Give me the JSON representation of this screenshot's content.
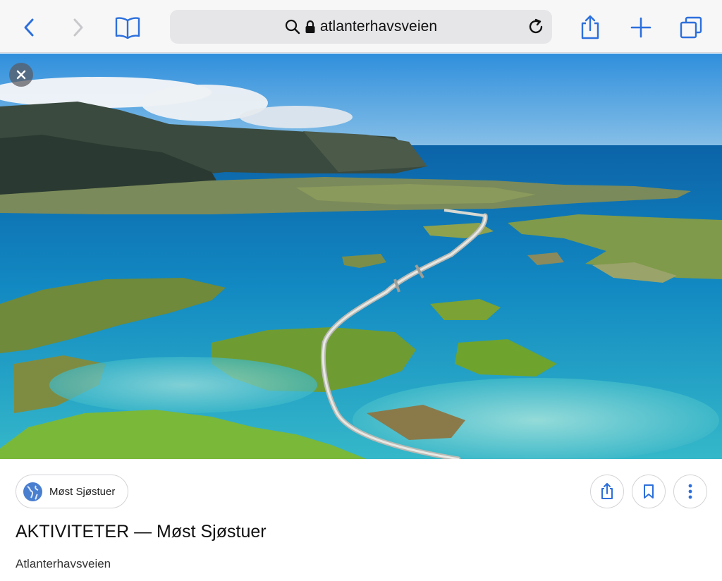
{
  "browser": {
    "url_text": "atlanterhavsveien",
    "buttons": [
      "back",
      "forward",
      "bookmarks",
      "share",
      "new-tab",
      "tabs"
    ],
    "accent_color": "#2c6fdc"
  },
  "image": {
    "description_hidden": ""
  },
  "result": {
    "source_label": "Møst Sjøstuer",
    "title": "AKTIVITETER — Møst Sjøstuer",
    "subtitle": "Atlanterhavsveien"
  },
  "icons": {
    "back": "chevron-left-icon",
    "forward": "chevron-right-icon",
    "bookmarks": "book-icon",
    "search": "magnifier-icon",
    "lock": "lock-icon",
    "reload": "reload-icon",
    "share": "share-icon",
    "new_tab": "plus-icon",
    "tabs": "tabs-icon",
    "close": "close-icon",
    "globe": "globe-icon",
    "bookmark": "bookmark-icon",
    "more": "more-vertical-icon"
  }
}
